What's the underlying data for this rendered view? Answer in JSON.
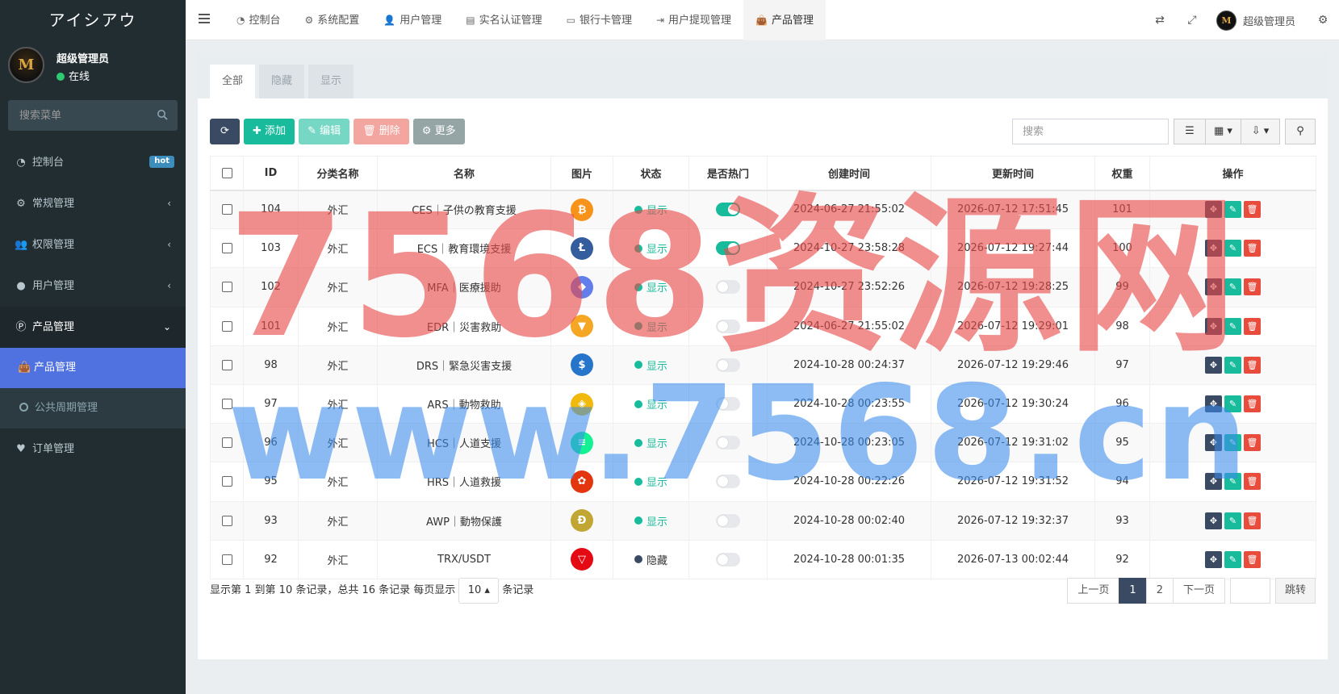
{
  "brand": {
    "title": "アイシアウ",
    "avatar_text": "M"
  },
  "user": {
    "name": "超级管理员",
    "status": "在线"
  },
  "sidebar": {
    "search_placeholder": "搜索菜单",
    "items": [
      {
        "label": "控制台",
        "icon": "dashboard-icon",
        "badge": "hot"
      },
      {
        "label": "常规管理",
        "icon": "cogs-icon",
        "arrow": "‹"
      },
      {
        "label": "权限管理",
        "icon": "users-icon",
        "arrow": "‹"
      },
      {
        "label": "用户管理",
        "icon": "user-circle-icon",
        "arrow": "‹"
      },
      {
        "label": "产品管理",
        "icon": "product-icon",
        "arrow": "⌄"
      }
    ],
    "submenu": [
      {
        "label": "产品管理",
        "icon": "shopping-bag-icon"
      },
      {
        "label": "公共周期管理",
        "icon": "circle-o-icon"
      }
    ],
    "extra": {
      "label": "订单管理",
      "icon": "heartbeat-icon"
    }
  },
  "topnav": {
    "tabs": [
      {
        "label": "控制台",
        "icon": "dashboard-icon"
      },
      {
        "label": "系统配置",
        "icon": "cog-icon"
      },
      {
        "label": "用户管理",
        "icon": "user-icon"
      },
      {
        "label": "实名认证管理",
        "icon": "id-card-icon"
      },
      {
        "label": "银行卡管理",
        "icon": "credit-card-icon"
      },
      {
        "label": "用户提现管理",
        "icon": "sign-out-icon"
      },
      {
        "label": "产品管理",
        "icon": "shopping-bag-icon"
      }
    ],
    "admin_name": "超级管理员"
  },
  "panel_tabs": [
    "全部",
    "隐藏",
    "显示"
  ],
  "toolbar": {
    "add": "添加",
    "edit": "编辑",
    "delete": "删除",
    "more": "更多"
  },
  "search_placeholder": "搜索",
  "table": {
    "headers": [
      "ID",
      "分类名称",
      "名称",
      "图片",
      "状态",
      "是否热门",
      "创建时间",
      "更新时间",
      "权重",
      "操作"
    ],
    "rows": [
      {
        "id": "104",
        "cat": "外汇",
        "name": "CES｜子供の教育支援",
        "coin": "bitcoin",
        "coin_color": "#f7931a",
        "coin_glyph": "₿",
        "status": "显示",
        "status_type": "show",
        "hot": true,
        "created": "2024-06-27 21:55:02",
        "updated": "2026-07-12 17:51:45",
        "weight": "101"
      },
      {
        "id": "103",
        "cat": "外汇",
        "name": "ECS｜教育環境支援",
        "coin": "litecoin",
        "coin_color": "#345d9d",
        "coin_glyph": "Ł",
        "status": "显示",
        "status_type": "show",
        "hot": true,
        "created": "2024-10-27 23:58:28",
        "updated": "2026-07-12 19:27:44",
        "weight": "100"
      },
      {
        "id": "102",
        "cat": "外汇",
        "name": "MFA｜医療援助",
        "coin": "ethereum",
        "coin_color": "#627eea",
        "coin_glyph": "◆",
        "status": "显示",
        "status_type": "show",
        "hot": false,
        "created": "2024-10-27 23:52:26",
        "updated": "2026-07-12 19:28:25",
        "weight": "99"
      },
      {
        "id": "101",
        "cat": "外汇",
        "name": "EDR｜災害救助",
        "coin": "tron-orange",
        "coin_color": "#f5a623",
        "coin_glyph": "▼",
        "status": "显示",
        "status_type": "show",
        "hot": false,
        "created": "2024-06-27 21:55:02",
        "updated": "2026-07-12 19:29:01",
        "weight": "98"
      },
      {
        "id": "98",
        "cat": "外汇",
        "name": "DRS｜緊急災害支援",
        "coin": "usdc",
        "coin_color": "#2775ca",
        "coin_glyph": "$",
        "status": "显示",
        "status_type": "show",
        "hot": false,
        "created": "2024-10-28 00:24:37",
        "updated": "2026-07-12 19:29:46",
        "weight": "97"
      },
      {
        "id": "97",
        "cat": "外汇",
        "name": "ARS｜動物救助",
        "coin": "binance",
        "coin_color": "#f0b90b",
        "coin_glyph": "◈",
        "status": "显示",
        "status_type": "show",
        "hot": false,
        "created": "2024-10-28 00:23:55",
        "updated": "2026-07-12 19:30:24",
        "weight": "96"
      },
      {
        "id": "96",
        "cat": "外汇",
        "name": "HCS｜人道支援",
        "coin": "solana",
        "coin_color": "#14f195",
        "coin_glyph": "≡",
        "status": "显示",
        "status_type": "show",
        "hot": false,
        "created": "2024-10-28 00:23:05",
        "updated": "2026-07-12 19:31:02",
        "weight": "95"
      },
      {
        "id": "95",
        "cat": "外汇",
        "name": "HRS｜人道救援",
        "coin": "shiba",
        "coin_color": "#e4360e",
        "coin_glyph": "✿",
        "status": "显示",
        "status_type": "show",
        "hot": false,
        "created": "2024-10-28 00:22:26",
        "updated": "2026-07-12 19:31:52",
        "weight": "94"
      },
      {
        "id": "93",
        "cat": "外汇",
        "name": "AWP｜動物保護",
        "coin": "dogecoin",
        "coin_color": "#c2a633",
        "coin_glyph": "Ð",
        "status": "显示",
        "status_type": "show",
        "hot": false,
        "created": "2024-10-28 00:02:40",
        "updated": "2026-07-12 19:32:37",
        "weight": "93"
      },
      {
        "id": "92",
        "cat": "外汇",
        "name": "TRX/USDT",
        "coin": "tron",
        "coin_color": "#e50914",
        "coin_glyph": "▽",
        "status": "隐藏",
        "status_type": "hide",
        "hot": false,
        "created": "2024-10-28 00:01:35",
        "updated": "2026-07-13 00:02:44",
        "weight": "92"
      }
    ]
  },
  "footer": {
    "info_prefix": "显示第 1 到第 10 条记录，总共 16 条记录 每页显示",
    "page_size": "10",
    "info_suffix": "条记录"
  },
  "pager": {
    "prev": "上一页",
    "pages": [
      "1",
      "2"
    ],
    "current": "1",
    "next": "下一页",
    "jump": "跳转"
  },
  "watermark": {
    "line1": "7568资源网",
    "line2": "www.7568.cn"
  },
  "colors": {
    "sidebar_bg": "#222d32",
    "active_menu": "#4f72e0",
    "success": "#18bc9c",
    "danger": "#e74c3c",
    "dark": "#3b4a63"
  }
}
